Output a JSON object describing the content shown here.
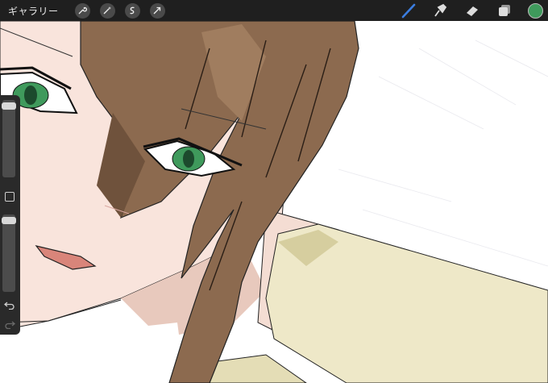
{
  "topbar": {
    "gallery_label": "ギャラリー",
    "left_tools": [
      "wrench-icon",
      "magic-wand-icon",
      "selection-icon",
      "transform-arrow-icon"
    ],
    "right_tools": [
      "brush-icon",
      "smudge-icon",
      "eraser-icon",
      "layers-icon"
    ],
    "active_tool": "brush-icon",
    "active_tool_color": "#3b7de0",
    "current_color": "#3f9a5c"
  },
  "sidebar": {
    "brush_size_level": 0.03,
    "opacity_level": 0.04,
    "icons": [
      "modify-square-icon",
      "undo-icon",
      "redo-icon"
    ]
  },
  "artwork": {
    "skin": "#f9e4dc",
    "hair": "#8c6a4f",
    "eyes": "#3f9a5c",
    "sleeve": "#eee8c8"
  }
}
